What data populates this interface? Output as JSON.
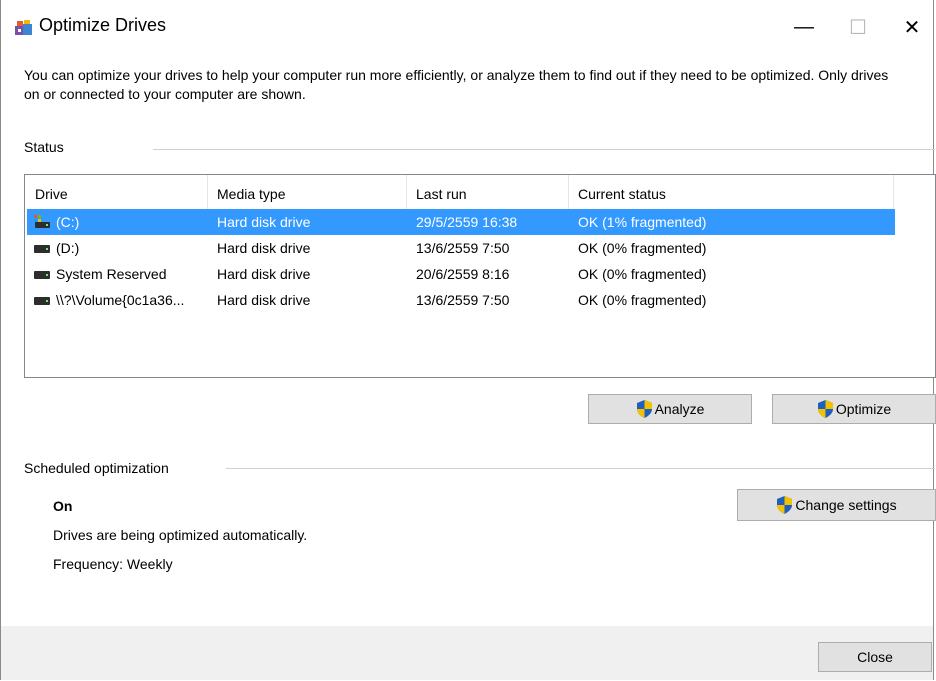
{
  "window": {
    "title": "Optimize Drives",
    "controls": {
      "minimize": "—",
      "maximize": "☐",
      "close": "✕"
    }
  },
  "description": "You can optimize your drives to help your computer run more efficiently, or analyze them to find out if they need to be optimized. Only drives on or connected to your computer are shown.",
  "status": {
    "label": "Status",
    "columns": [
      "Drive",
      "Media type",
      "Last run",
      "Current status"
    ],
    "rows": [
      {
        "drive": "(C:)",
        "icon": "system-drive-icon",
        "media": "Hard disk drive",
        "last_run": "29/5/2559 16:38",
        "status": "OK (1% fragmented)",
        "selected": true
      },
      {
        "drive": "(D:)",
        "icon": "drive-icon",
        "media": "Hard disk drive",
        "last_run": "13/6/2559 7:50",
        "status": "OK (0% fragmented)",
        "selected": false
      },
      {
        "drive": "System Reserved",
        "icon": "drive-icon",
        "media": "Hard disk drive",
        "last_run": "20/6/2559 8:16",
        "status": "OK (0% fragmented)",
        "selected": false
      },
      {
        "drive": "\\\\?\\Volume{0c1a36...",
        "icon": "drive-icon",
        "media": "Hard disk drive",
        "last_run": "13/6/2559 7:50",
        "status": "OK (0% fragmented)",
        "selected": false
      }
    ],
    "analyze_label": "Analyze",
    "optimize_label": "Optimize"
  },
  "scheduled": {
    "label": "Scheduled optimization",
    "state": "On",
    "message": "Drives are being optimized automatically.",
    "frequency": "Frequency: Weekly",
    "change_settings_label": "Change settings"
  },
  "footer": {
    "close_label": "Close"
  },
  "colors": {
    "selection": "#3399ff",
    "button_face": "#e1e1e1",
    "footer_bg": "#f0f0f0"
  }
}
